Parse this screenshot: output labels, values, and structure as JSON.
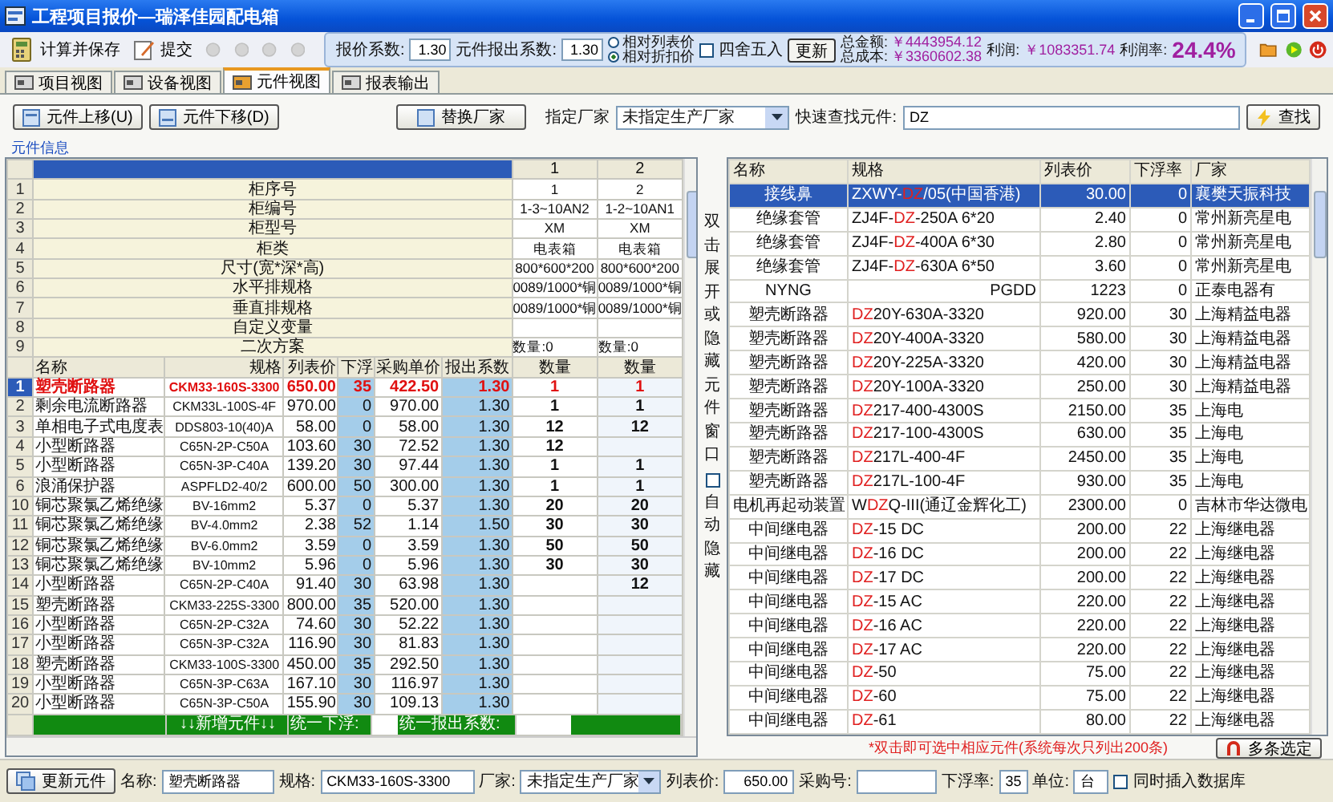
{
  "window": {
    "title": "工程项目报价—瑞泽佳园配电箱"
  },
  "toolbar": {
    "actions": [
      {
        "label": "计算并保存"
      },
      {
        "label": "提交"
      }
    ],
    "fields": [
      {
        "label": "报价系数:",
        "value": "1.30"
      },
      {
        "label": "元件报出系数:",
        "value": "1.30"
      }
    ],
    "modes": [
      {
        "label": "相对列表价",
        "selected": false
      },
      {
        "label": "相对折扣价",
        "selected": true
      }
    ],
    "rounding": {
      "label": "四舍五入",
      "checked": false
    },
    "update_button": "更新",
    "totals": [
      {
        "label": "总金额:",
        "value": "￥4443954.12"
      },
      {
        "label": "总成本:",
        "value": "￥3360602.38"
      }
    ],
    "profit": {
      "label": "利润:",
      "value": "￥1083351.74"
    },
    "margin": {
      "label": "利润率:",
      "value": "24.4%"
    }
  },
  "tabs": [
    {
      "label": "项目视图",
      "selected": false
    },
    {
      "label": "设备视图",
      "selected": false
    },
    {
      "label": "元件视图",
      "selected": true
    },
    {
      "label": "报表输出",
      "selected": false
    }
  ],
  "controls": {
    "move_up": "元件上移(U)",
    "move_down": "元件下移(D)",
    "replace": "替换厂家",
    "vendor_label": "指定厂家",
    "vendor_value": "未指定生产厂家",
    "find_label": "快速查找元件:",
    "find_value": "DZ",
    "find_button": "查找"
  },
  "section_label": "元件信息",
  "left_grid": {
    "top_columns": [
      "1",
      "2"
    ],
    "attributes": [
      {
        "index": "1",
        "label": "柜序号",
        "values": [
          "1",
          "2"
        ]
      },
      {
        "index": "2",
        "label": "柜编号",
        "values": [
          "1-3~10AN2",
          "1-2~10AN1"
        ]
      },
      {
        "index": "3",
        "label": "柜型号",
        "values": [
          "XM",
          "XM"
        ]
      },
      {
        "index": "4",
        "label": "柜类",
        "values": [
          "电表箱",
          "电表箱"
        ]
      },
      {
        "index": "5",
        "label": "尺寸(宽*深*高)",
        "values": [
          "800*600*200",
          "800*600*200"
        ]
      },
      {
        "index": "6",
        "label": "水平排规格",
        "values": [
          "0089/1000*铜",
          "0089/1000*铜"
        ]
      },
      {
        "index": "7",
        "label": "垂直排规格",
        "values": [
          "0089/1000*铜",
          "0089/1000*铜"
        ]
      },
      {
        "index": "8",
        "label": "自定义变量"
      },
      {
        "index": "9",
        "label": "二次方案",
        "values": [
          "数量:0",
          "数量:0"
        ]
      }
    ],
    "columns": [
      "名称",
      "规格",
      "列表价",
      "下浮",
      "采购单价",
      "报出系数",
      "数量",
      "数量"
    ],
    "rows": [
      {
        "index": "1",
        "name": "塑壳断路器",
        "spec": "CKM33-160S-3300",
        "list": "650.00",
        "down": "35",
        "unit": "422.50",
        "coef": "1.30",
        "qty_1": "1",
        "qty_2": "1",
        "selected": true
      },
      {
        "index": "2",
        "name": "剩余电流断路器",
        "spec": "CKM33L-100S-4F",
        "list": "970.00",
        "down": "0",
        "unit": "970.00",
        "coef": "1.30",
        "qty_1": "1",
        "qty_2": "1",
        "selected": false
      },
      {
        "index": "3",
        "name": "单相电子式电度表",
        "spec": "DDS803-10(40)A",
        "list": "58.00",
        "down": "0",
        "unit": "58.00",
        "coef": "1.30",
        "qty_1": "12",
        "qty_2": "12",
        "selected": false
      },
      {
        "index": "4",
        "name": "小型断路器",
        "spec": "C65N-2P-C50A",
        "list": "103.60",
        "down": "30",
        "unit": "72.52",
        "coef": "1.30",
        "qty_1": "12",
        "selected": false
      },
      {
        "index": "5",
        "name": "小型断路器",
        "spec": "C65N-3P-C40A",
        "list": "139.20",
        "down": "30",
        "unit": "97.44",
        "coef": "1.30",
        "qty_1": "1",
        "qty_2": "1",
        "selected": false
      },
      {
        "index": "6",
        "name": "浪涌保护器",
        "spec": "ASPFLD2-40/2",
        "list": "600.00",
        "down": "50",
        "unit": "300.00",
        "coef": "1.30",
        "qty_1": "1",
        "qty_2": "1",
        "selected": false
      },
      {
        "index": "10",
        "name": "铜芯聚氯乙烯绝缘",
        "spec": "BV-16mm2",
        "list": "5.37",
        "down": "0",
        "unit": "5.37",
        "coef": "1.30",
        "qty_1": "20",
        "qty_2": "20",
        "selected": false
      },
      {
        "index": "11",
        "name": "铜芯聚氯乙烯绝缘",
        "spec": "BV-4.0mm2",
        "list": "2.38",
        "down": "52",
        "unit": "1.14",
        "coef": "1.50",
        "qty_1": "30",
        "qty_2": "30",
        "selected": false
      },
      {
        "index": "12",
        "name": "铜芯聚氯乙烯绝缘",
        "spec": "BV-6.0mm2",
        "list": "3.59",
        "down": "0",
        "unit": "3.59",
        "coef": "1.30",
        "qty_1": "50",
        "qty_2": "50",
        "selected": false
      },
      {
        "index": "13",
        "name": "铜芯聚氯乙烯绝缘",
        "spec": "BV-10mm2",
        "list": "5.96",
        "down": "0",
        "unit": "5.96",
        "coef": "1.30",
        "qty_1": "30",
        "qty_2": "30",
        "selected": false
      },
      {
        "index": "14",
        "name": "小型断路器",
        "spec": "C65N-2P-C40A",
        "list": "91.40",
        "down": "30",
        "unit": "63.98",
        "coef": "1.30",
        "qty_2": "12",
        "selected": false
      },
      {
        "index": "15",
        "name": "塑壳断路器",
        "spec": "CKM33-225S-3300",
        "list": "800.00",
        "down": "35",
        "unit": "520.00",
        "coef": "1.30",
        "selected": false
      },
      {
        "index": "16",
        "name": "小型断路器",
        "spec": "C65N-2P-C32A",
        "list": "74.60",
        "down": "30",
        "unit": "52.22",
        "coef": "1.30",
        "selected": false
      },
      {
        "index": "17",
        "name": "小型断路器",
        "spec": "C65N-3P-C32A",
        "list": "116.90",
        "down": "30",
        "unit": "81.83",
        "coef": "1.30",
        "selected": false
      },
      {
        "index": "18",
        "name": "塑壳断路器",
        "spec": "CKM33-100S-3300",
        "list": "450.00",
        "down": "35",
        "unit": "292.50",
        "coef": "1.30",
        "selected": false
      },
      {
        "index": "19",
        "name": "小型断路器",
        "spec": "C65N-3P-C63A",
        "list": "167.10",
        "down": "30",
        "unit": "116.97",
        "coef": "1.30",
        "selected": false
      },
      {
        "index": "20",
        "name": "小型断路器",
        "spec": "C65N-3P-C50A",
        "list": "155.90",
        "down": "30",
        "unit": "109.13",
        "coef": "1.30",
        "selected": false
      }
    ],
    "footer": {
      "add": "↓↓新增元件↓↓",
      "uniform_down": "统一下浮:",
      "uniform_coef": "统一报出系数:"
    }
  },
  "side_panel": {
    "toggle_text": "双击展开或隐藏元件窗口",
    "auto_hide": {
      "label": "自动隐藏",
      "checked": false
    }
  },
  "parts_table": {
    "columns": [
      "名称",
      "规格",
      "列表价",
      "下浮率",
      "厂家"
    ],
    "rows": [
      {
        "name": "接线鼻",
        "spec_pre": "ZXWY-",
        "hit": "DZ",
        "spec_post": "/05(中国香港)",
        "list": "30.00",
        "down": "0",
        "vendor": "襄樊天振科技",
        "selected": true
      },
      {
        "name": "绝缘套管",
        "spec_pre": "ZJ4F-",
        "hit": "DZ",
        "spec_post": "-250A 6*20",
        "list": "2.40",
        "down": "0",
        "vendor": "常州新亮星电",
        "selected": false
      },
      {
        "name": "绝缘套管",
        "spec_pre": "ZJ4F-",
        "hit": "DZ",
        "spec_post": "-400A 6*30",
        "list": "2.80",
        "down": "0",
        "vendor": "常州新亮星电",
        "selected": false
      },
      {
        "name": "绝缘套管",
        "spec_pre": "ZJ4F-",
        "hit": "DZ",
        "spec_post": "-630A 6*50",
        "list": "3.60",
        "down": "0",
        "vendor": "常州新亮星电",
        "selected": false
      },
      {
        "name": "NYNG",
        "spec_right": "PGDD",
        "list": "1223",
        "down": "0",
        "vendor": "正泰电器有",
        "selected": false
      },
      {
        "name": "塑壳断路器",
        "hit": "DZ",
        "spec_post": "20Y-630A-3320",
        "list": "920.00",
        "down": "30",
        "vendor": "上海精益电器",
        "selected": false
      },
      {
        "name": "塑壳断路器",
        "hit": "DZ",
        "spec_post": "20Y-400A-3320",
        "list": "580.00",
        "down": "30",
        "vendor": "上海精益电器",
        "selected": false
      },
      {
        "name": "塑壳断路器",
        "hit": "DZ",
        "spec_post": "20Y-225A-3320",
        "list": "420.00",
        "down": "30",
        "vendor": "上海精益电器",
        "selected": false
      },
      {
        "name": "塑壳断路器",
        "hit": "DZ",
        "spec_post": "20Y-100A-3320",
        "list": "250.00",
        "down": "30",
        "vendor": "上海精益电器",
        "selected": false
      },
      {
        "name": "塑壳断路器",
        "hit": "DZ",
        "spec_post": "217-400-4300S",
        "list": "2150.00",
        "down": "35",
        "vendor": "上海电",
        "selected": false
      },
      {
        "name": "塑壳断路器",
        "hit": "DZ",
        "spec_post": "217-100-4300S",
        "list": "630.00",
        "down": "35",
        "vendor": "上海电",
        "selected": false
      },
      {
        "name": "塑壳断路器",
        "hit": "DZ",
        "spec_post": "217L-400-4F",
        "list": "2450.00",
        "down": "35",
        "vendor": "上海电",
        "selected": false
      },
      {
        "name": "塑壳断路器",
        "hit": "DZ",
        "spec_post": "217L-100-4F",
        "list": "930.00",
        "down": "35",
        "vendor": "上海电",
        "selected": false
      },
      {
        "name": "电机再起动装置",
        "spec_pre": "W",
        "hit": "DZ",
        "spec_post": "Q-III(通辽金辉化工)",
        "list": "2300.00",
        "down": "0",
        "vendor": "吉林市华达微电",
        "selected": false
      },
      {
        "name": "中间继电器",
        "hit": "DZ",
        "spec_post": "-15 DC",
        "list": "200.00",
        "down": "22",
        "vendor": "上海继电器",
        "selected": false
      },
      {
        "name": "中间继电器",
        "hit": "DZ",
        "spec_post": "-16 DC",
        "list": "200.00",
        "down": "22",
        "vendor": "上海继电器",
        "selected": false
      },
      {
        "name": "中间继电器",
        "hit": "DZ",
        "spec_post": "-17 DC",
        "list": "200.00",
        "down": "22",
        "vendor": "上海继电器",
        "selected": false
      },
      {
        "name": "中间继电器",
        "hit": "DZ",
        "spec_post": "-15 AC",
        "list": "220.00",
        "down": "22",
        "vendor": "上海继电器",
        "selected": false
      },
      {
        "name": "中间继电器",
        "hit": "DZ",
        "spec_post": "-16 AC",
        "list": "220.00",
        "down": "22",
        "vendor": "上海继电器",
        "selected": false
      },
      {
        "name": "中间继电器",
        "hit": "DZ",
        "spec_post": "-17 AC",
        "list": "220.00",
        "down": "22",
        "vendor": "上海继电器",
        "selected": false
      },
      {
        "name": "中间继电器",
        "hit": "DZ",
        "spec_post": "-50",
        "list": "75.00",
        "down": "22",
        "vendor": "上海继电器",
        "selected": false
      },
      {
        "name": "中间继电器",
        "hit": "DZ",
        "spec_post": "-60",
        "list": "75.00",
        "down": "22",
        "vendor": "上海继电器",
        "selected": false
      },
      {
        "name": "中间继电器",
        "hit": "DZ",
        "spec_post": "-61",
        "list": "80.00",
        "down": "22",
        "vendor": "上海继电器",
        "selected": false
      }
    ]
  },
  "note": "*双击即可选中相应元件(系统每次只列出200条)",
  "multi_select_button": "多条选定",
  "editor": {
    "update_button": "更新元件",
    "name": {
      "label": "名称:",
      "value": "塑壳断路器"
    },
    "spec": {
      "label": "规格:",
      "value": "CKM33-160S-3300"
    },
    "vendor": {
      "label": "厂家:",
      "value": "未指定生产厂家"
    },
    "list": {
      "label": "列表价:",
      "value": "650.00"
    },
    "purchase_no": {
      "label": "采购号:"
    },
    "down": {
      "label": "下浮率:",
      "value": "35"
    },
    "unit": {
      "label": "单位:",
      "value": "台"
    },
    "insert_db": {
      "label": "同时插入数据库",
      "checked": false
    }
  }
}
